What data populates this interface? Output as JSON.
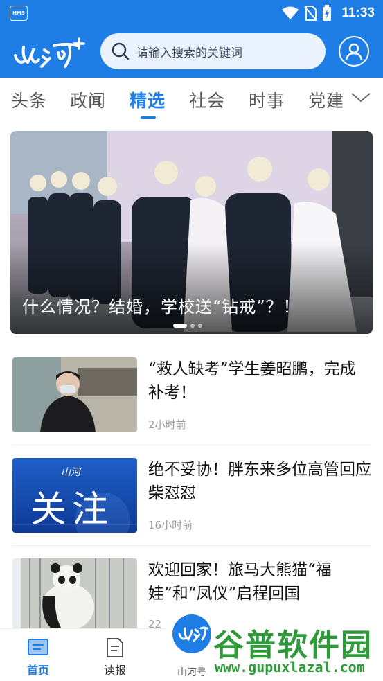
{
  "status_bar": {
    "badge": "HMS",
    "time": "11:33"
  },
  "header": {
    "logo_text": "山河",
    "search_placeholder": "请输入搜索的关键词"
  },
  "tabs": [
    {
      "label": "头条",
      "active": false
    },
    {
      "label": "政闻",
      "active": false
    },
    {
      "label": "精选",
      "active": true
    },
    {
      "label": "社会",
      "active": false
    },
    {
      "label": "时事",
      "active": false
    },
    {
      "label": "党建",
      "active": false
    }
  ],
  "banner": {
    "title": "什么情况？结婚，学校送“钻戒”？！",
    "slides": 3,
    "current_slide": 1
  },
  "news": [
    {
      "title": "“救人缺考”学生姜昭鹏，完成补考！",
      "time": "2小时前"
    },
    {
      "title": "绝不妥协！胖东来多位高管回应柴怼怼",
      "time": "16小时前",
      "thumb_text": "关注",
      "thumb_logo": "山河"
    },
    {
      "title": "欢迎回家！旅马大熊猫“福娃”和“凤仪”启程回国",
      "time": "22"
    }
  ],
  "bottom_nav": [
    {
      "label": "首页",
      "icon": "home-icon",
      "active": true
    },
    {
      "label": "读报",
      "icon": "newspaper-icon",
      "active": false
    },
    {
      "label": "山河号",
      "icon": "shanhe-logo-icon",
      "active": false
    }
  ],
  "watermark": {
    "title": "谷普软件园",
    "url": "www.gupuxlazal.com"
  },
  "colors": {
    "brand": "#1e7ee6",
    "active_tab": "#1e7ee6",
    "time_text": "#999999"
  }
}
